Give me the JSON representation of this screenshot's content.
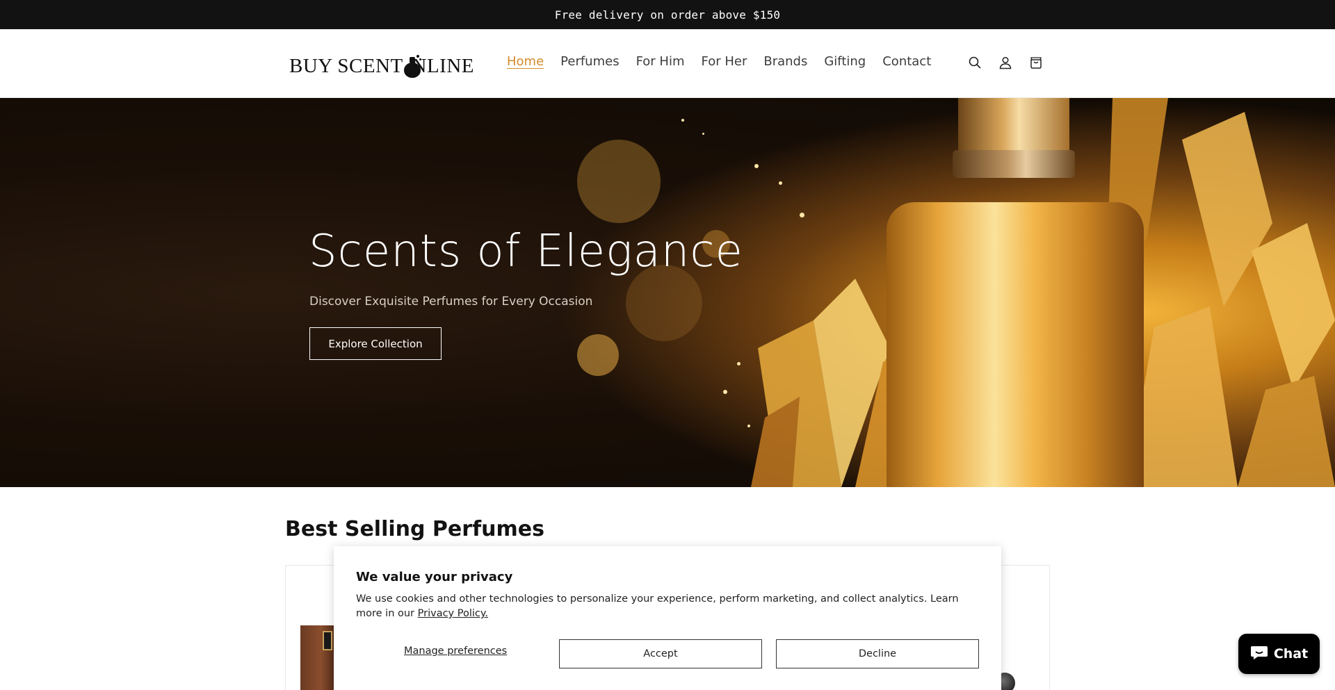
{
  "announcement": {
    "text": "Free delivery on order above $150"
  },
  "header": {
    "logo_text_before": "BUY SCENT ",
    "logo_text_after": "NLINE",
    "nav": [
      {
        "label": "Home",
        "active": true
      },
      {
        "label": "Perfumes",
        "active": false
      },
      {
        "label": "For Him",
        "active": false
      },
      {
        "label": "For Her",
        "active": false
      },
      {
        "label": "Brands",
        "active": false
      },
      {
        "label": "Gifting",
        "active": false
      },
      {
        "label": "Contact",
        "active": false
      }
    ],
    "icons": [
      "search-icon",
      "account-icon",
      "cart-icon"
    ]
  },
  "hero": {
    "title": "Scents of Elegance",
    "subtitle": "Discover Exquisite Perfumes for Every Occasion",
    "button_label": "Explore Collection"
  },
  "best_selling": {
    "title": "Best Selling Perfumes"
  },
  "cookie": {
    "title": "We value your privacy",
    "text": "We use cookies and other technologies to personalize your experience, perform marketing, and collect analytics. Learn more in our ",
    "policy_link": "Privacy Policy.",
    "manage_label": "Manage preferences",
    "accept_label": "Accept",
    "decline_label": "Decline"
  },
  "chat": {
    "label": "Chat"
  },
  "colors": {
    "accent": "#d58a2a",
    "announcement_bg": "#121212",
    "chat_bg": "#000000"
  }
}
